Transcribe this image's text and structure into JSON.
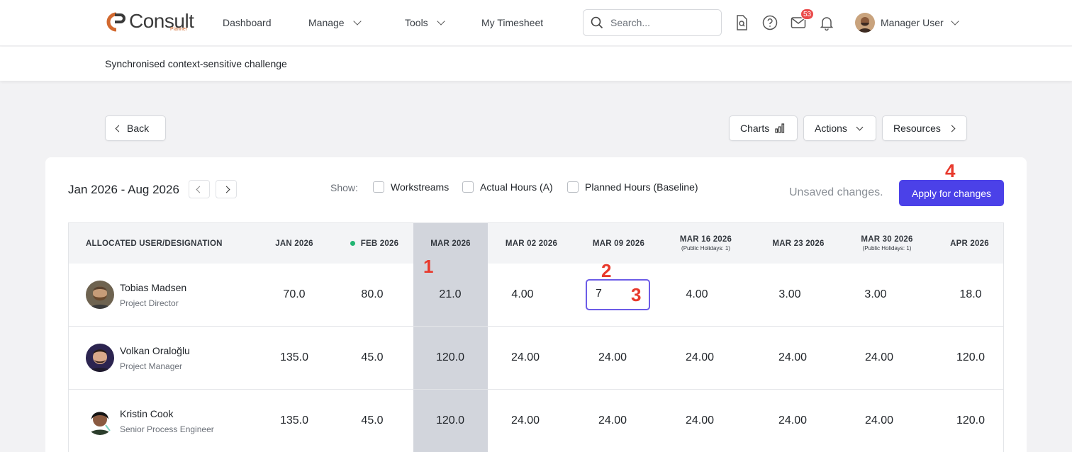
{
  "brand": {
    "name": "Consult",
    "sub": "Planner"
  },
  "nav": {
    "dashboard": "Dashboard",
    "manage": "Manage",
    "tools": "Tools",
    "timesheet": "My Timesheet"
  },
  "search": {
    "placeholder": "Search..."
  },
  "notifications": {
    "mail_count": "53"
  },
  "user": {
    "name": "Manager User"
  },
  "project": {
    "title": "Synchronised context-sensitive challenge"
  },
  "toolbar": {
    "back": "Back",
    "charts": "Charts",
    "actions": "Actions",
    "resources": "Resources"
  },
  "range": {
    "label": "Jan 2026 - Aug 2026"
  },
  "show": {
    "label": "Show:",
    "workstreams": "Workstreams",
    "actual": "Actual Hours (A)",
    "planned": "Planned Hours (Baseline)"
  },
  "status": {
    "unsaved": "Unsaved changes."
  },
  "apply": {
    "label": "Apply for changes"
  },
  "table": {
    "user_header": "ALLOCATED USER/DESIGNATION",
    "columns": [
      {
        "label": "JAN 2026",
        "note": ""
      },
      {
        "label": "FEB 2026",
        "note": ""
      },
      {
        "label": "MAR 2026",
        "note": ""
      },
      {
        "label": "MAR 02 2026",
        "note": ""
      },
      {
        "label": "MAR 09 2026",
        "note": ""
      },
      {
        "label": "MAR 16 2026",
        "note": "(Public Holidays: 1)"
      },
      {
        "label": "MAR 23 2026",
        "note": ""
      },
      {
        "label": "MAR 30 2026",
        "note": "(Public Holidays: 1)"
      },
      {
        "label": "APR 2026",
        "note": ""
      }
    ],
    "rows": [
      {
        "name": "Tobias Madsen",
        "role": "Project Director",
        "values": [
          "70.0",
          "80.0",
          "21.0",
          "4.00",
          "7",
          "4.00",
          "3.00",
          "3.00",
          "18.0"
        ]
      },
      {
        "name": "Volkan Oraloğlu",
        "role": "Project Manager",
        "values": [
          "135.0",
          "45.0",
          "120.0",
          "24.00",
          "24.00",
          "24.00",
          "24.00",
          "24.00",
          "120.0"
        ]
      },
      {
        "name": "Kristin Cook",
        "role": "Senior Process Engineer",
        "values": [
          "135.0",
          "45.0",
          "120.0",
          "24.00",
          "24.00",
          "24.00",
          "24.00",
          "24.00",
          "120.0"
        ]
      }
    ]
  },
  "markers": {
    "m1": "1",
    "m2": "2",
    "m3": "3",
    "m4": "4"
  },
  "colors": {
    "accent": "#4b41e8",
    "marker": "#e8392c",
    "highlight_column": "#d2d5dc",
    "badge": "#ea4b4b"
  }
}
